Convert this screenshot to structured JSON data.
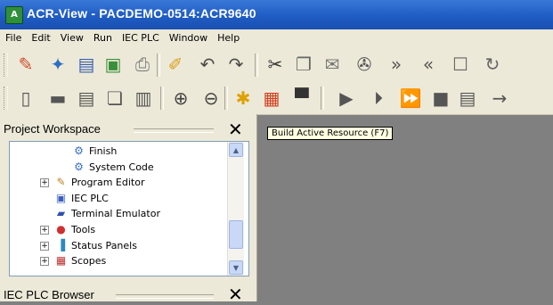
{
  "window": {
    "title": "ACR-View - PACDEMO-0514:ACR9640",
    "app_icon": "acr-view-app-icon"
  },
  "menu": [
    "File",
    "Edit",
    "View",
    "Run",
    "IEC PLC",
    "Window",
    "Help"
  ],
  "toolbar1": [
    {
      "name": "wrench-icon",
      "glyph": "✎",
      "color": "#d04a2a"
    },
    {
      "name": "tools-icon",
      "glyph": "✦",
      "color": "#2c6fc2"
    },
    {
      "name": "save-icon",
      "glyph": "▤",
      "color": "#3a5fb0"
    },
    {
      "name": "save-all-icon",
      "glyph": "▣",
      "color": "#3a8f3a"
    },
    {
      "name": "print-icon",
      "glyph": "⎙",
      "color": "#777777"
    },
    {
      "name": "iec-edit-icon",
      "glyph": "✐",
      "color": "#d8a020"
    },
    {
      "name": "undo-icon",
      "glyph": "↶",
      "color": "#4a4a4a"
    },
    {
      "name": "redo-icon",
      "glyph": "↷",
      "color": "#4a4a4a"
    },
    {
      "name": "cut-icon",
      "glyph": "✂",
      "color": "#333333"
    },
    {
      "name": "copy-icon",
      "glyph": "❐",
      "color": "#666666"
    },
    {
      "name": "paste-icon",
      "glyph": "✉",
      "color": "#777777"
    },
    {
      "name": "find-icon",
      "glyph": "✇",
      "color": "#555555"
    },
    {
      "name": "forward-icon",
      "glyph": "»",
      "color": "#555555"
    },
    {
      "name": "back-icon",
      "glyph": "«",
      "color": "#555555"
    },
    {
      "name": "document-icon",
      "glyph": "☐",
      "color": "#666666"
    },
    {
      "name": "refresh-icon",
      "glyph": "↻",
      "color": "#666666"
    }
  ],
  "toolbar2": [
    {
      "name": "new-file-icon",
      "glyph": "▯",
      "color": "#555555"
    },
    {
      "name": "open-folder-icon",
      "glyph": "▬",
      "color": "#555555"
    },
    {
      "name": "save-file-icon",
      "glyph": "▤",
      "color": "#555555"
    },
    {
      "name": "copy-file-icon",
      "glyph": "❏",
      "color": "#555555"
    },
    {
      "name": "file-properties-icon",
      "glyph": "▥",
      "color": "#555555"
    },
    {
      "name": "zoom-in-icon",
      "glyph": "⊕",
      "color": "#444444"
    },
    {
      "name": "zoom-out-icon",
      "glyph": "⊖",
      "color": "#444444"
    },
    {
      "name": "build-active-resource-icon",
      "glyph": "✱",
      "color": "#e0a000"
    },
    {
      "name": "build-all-icon",
      "glyph": "▦",
      "color": "#d04020"
    },
    {
      "name": "monitor-icon",
      "glyph": "▀",
      "color": "#333333"
    },
    {
      "name": "run-icon",
      "glyph": "▶",
      "color": "#555555"
    },
    {
      "name": "step-icon",
      "glyph": "⏵",
      "color": "#555555"
    },
    {
      "name": "step-over-icon",
      "glyph": "⏩",
      "color": "#555555"
    },
    {
      "name": "stop-icon",
      "glyph": "■",
      "color": "#555555"
    },
    {
      "name": "page-icon",
      "glyph": "▤",
      "color": "#555555"
    },
    {
      "name": "step-into-icon",
      "glyph": "→",
      "color": "#555555"
    }
  ],
  "workspace": {
    "title": "Project Workspace",
    "close_glyph": "✕",
    "tree": [
      {
        "label": "Finish",
        "icon": "gear-icon",
        "glyph": "⚙",
        "color": "#3a70c0",
        "expander": false
      },
      {
        "label": "System Code",
        "icon": "gear-icon",
        "glyph": "⚙",
        "color": "#3a70c0",
        "expander": false
      },
      {
        "label": "Program Editor",
        "icon": "pencil-icon",
        "glyph": "✎",
        "color": "#c08020",
        "expander": true
      },
      {
        "label": "IEC PLC",
        "icon": "iec-icon",
        "glyph": "▣",
        "color": "#3a60c0",
        "expander": false
      },
      {
        "label": "Terminal Emulator",
        "icon": "terminal-icon",
        "glyph": "▰",
        "color": "#3050b0",
        "expander": false
      },
      {
        "label": "Tools",
        "icon": "tools-icon",
        "glyph": "●",
        "color": "#d03030",
        "expander": true
      },
      {
        "label": "Status Panels",
        "icon": "status-panels-icon",
        "glyph": "▐",
        "color": "#2c8ac0",
        "expander": true
      },
      {
        "label": "Scopes",
        "icon": "scopes-icon",
        "glyph": "▦",
        "color": "#c03030",
        "expander": true
      }
    ]
  },
  "browser_panel": {
    "title": "IEC PLC Browser",
    "close_glyph": "✕"
  },
  "tooltip": "Build Active Resource (F7)",
  "expander_glyph": "+",
  "scroll_up_glyph": "▲",
  "scroll_down_glyph": "▼"
}
